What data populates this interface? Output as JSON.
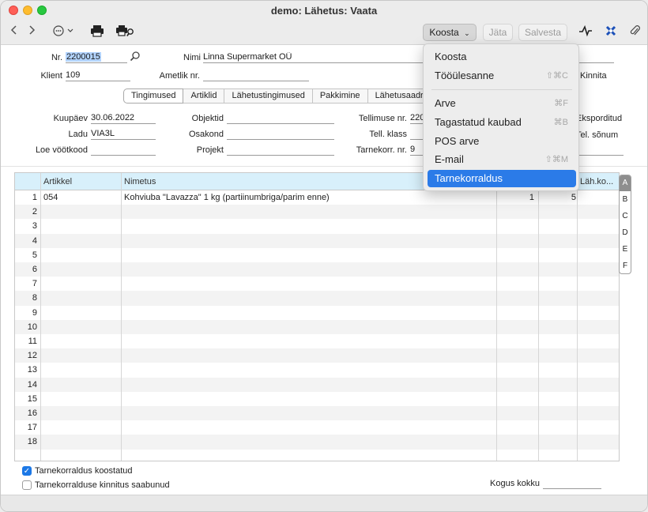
{
  "window": {
    "title": "demo: Lähetus: Vaata"
  },
  "toolbar": {
    "back_icon": "chevron-left-icon",
    "forward_icon": "chevron-right-icon",
    "more_icon": "ellipsis-circle-icon",
    "print_icon": "printer-icon",
    "print_preview_icon": "print-search-icon",
    "koosta_label": "Koosta",
    "jata_label": "Jäta",
    "salvesta_label": "Salvesta",
    "activity_icon": "activity-icon",
    "link_icon": "link-x-icon",
    "attachment_icon": "paperclip-icon"
  },
  "header": {
    "nr_label": "Nr.",
    "nr_value": "2200015",
    "nimi_label": "Nimi",
    "nimi_value": "Linna Supermarket OÜ",
    "klient_label": "Klient",
    "klient_value": "109",
    "ametlik_label": "Ametlik nr.",
    "ametlik_value": "",
    "kinnita_label": "Kinnita"
  },
  "tabs": [
    "Tingimused",
    "Artiklid",
    "Lähetustingimused",
    "Pakkimine",
    "Lähetusaadress"
  ],
  "terms": {
    "kuupaev_label": "Kuupäev",
    "kuupaev_value": "30.06.2022",
    "ladu_label": "Ladu",
    "ladu_value": "VIA3L",
    "loe_label": "Loe vöötkood",
    "loe_value": "",
    "objektid_label": "Objektid",
    "objektid_value": "",
    "osakond_label": "Osakond",
    "osakond_value": "",
    "projekt_label": "Projekt",
    "projekt_value": "",
    "tellimuse_label": "Tellimuse nr.",
    "tellimuse_value": "2200",
    "tellklass_label": "Tell. klass",
    "tellklass_value": "",
    "tarnekorr_label": "Tarnekorr. nr.",
    "tarnekorr_value": "9",
    "eksporditud_label": "Eksporditud",
    "sonum_label": "Tel. sõnum"
  },
  "grid": {
    "headers": [
      "Artikkel",
      "Nimetus",
      "Läh.ko..."
    ],
    "rows": [
      {
        "n": "1",
        "artikkel": "054",
        "nimetus": "Kohviuba \"Lavazza\" 1 kg (partiinumbriga/parim enne)",
        "q1": "1",
        "q2": "5"
      },
      {
        "n": "2"
      },
      {
        "n": "3"
      },
      {
        "n": "4"
      },
      {
        "n": "5"
      },
      {
        "n": "6"
      },
      {
        "n": "7"
      },
      {
        "n": "8"
      },
      {
        "n": "9"
      },
      {
        "n": "10"
      },
      {
        "n": "11"
      },
      {
        "n": "12"
      },
      {
        "n": "13"
      },
      {
        "n": "14"
      },
      {
        "n": "15"
      },
      {
        "n": "16"
      },
      {
        "n": "17"
      },
      {
        "n": "18"
      }
    ],
    "letters": [
      "A",
      "B",
      "C",
      "D",
      "E",
      "F"
    ]
  },
  "footer": {
    "chk1_label": "Tarnekorraldus koostatud",
    "chk1_checked": true,
    "chk2_label": "Tarnekorralduse kinnitus saabunud",
    "chk2_checked": false,
    "kogus_label": "Kogus kokku",
    "kogus_value": ""
  },
  "menu": {
    "items": [
      {
        "label": "Koosta",
        "shortcut": ""
      },
      {
        "label": "Tööülesanne",
        "shortcut": "⇧⌘C"
      },
      {
        "label": "Arve",
        "shortcut": "⌘F"
      },
      {
        "label": "Tagastatud kaubad",
        "shortcut": "⌘B"
      },
      {
        "label": "POS arve",
        "shortcut": ""
      },
      {
        "label": "E-mail",
        "shortcut": "⇧⌘M"
      },
      {
        "label": "Tarnekorraldus",
        "shortcut": ""
      }
    ]
  },
  "colors": {
    "accent": "#2b7be8",
    "grid_header": "#d8f0fb",
    "selection": "#b3d4ff"
  }
}
